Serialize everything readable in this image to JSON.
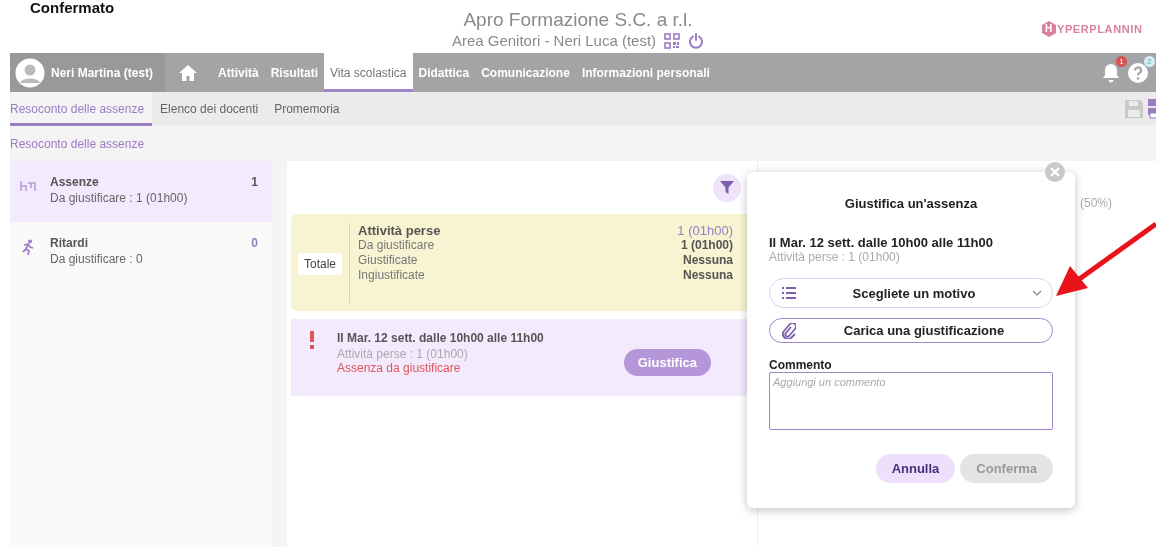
{
  "annotation": {
    "caption": "Confermato"
  },
  "header": {
    "title": "Apro Formazione S.C. a r.l.",
    "subtitle": "Area Genitori - Neri Luca (test)",
    "logo_initial": "H",
    "logo_rest": "YPERPLANNIN"
  },
  "nav": {
    "user": "Neri Martina (test)",
    "items": [
      {
        "label": "Attività",
        "selected": false
      },
      {
        "label": "Risultati",
        "selected": false
      },
      {
        "label": "Vita scolastica",
        "selected": true
      },
      {
        "label": "Didattica",
        "selected": false
      },
      {
        "label": "Comunicazione",
        "selected": false
      },
      {
        "label": "Informazioni personali",
        "selected": false
      }
    ],
    "notifications_badge": "1",
    "help_badge": "2"
  },
  "subtabs": [
    {
      "label": "Resoconto delle assenze",
      "selected": true
    },
    {
      "label": "Elenco dei docenti",
      "selected": false
    },
    {
      "label": "Promemoria",
      "selected": false
    }
  ],
  "breadcrumb": "Resoconto delle assenze",
  "sidebar": {
    "items": [
      {
        "kind": "absence",
        "label": "Assenze",
        "detail": "Da giustificare : 1 (01h00)",
        "count": "1",
        "selected": true
      },
      {
        "kind": "delay",
        "label": "Ritardi",
        "detail": "Da giustificare : 0",
        "count": "0",
        "selected": false
      }
    ]
  },
  "summary": {
    "tag": "Totale",
    "title": "Attività perse",
    "total": "1 (01h00)",
    "rows": [
      {
        "label": "Da giustificare",
        "value": "1 (01h00)"
      },
      {
        "label": "Giustificate",
        "value": "Nessuna"
      },
      {
        "label": "Ingiustificate",
        "value": "Nessuna"
      }
    ]
  },
  "absence": {
    "title": "Il Mar. 12 sett. dalle 10h00 alle 11h00",
    "detail": "Attività perse : 1 (01h00)",
    "status": "Assenza da giustificare",
    "button": "Giustifica"
  },
  "side_panel": {
    "percent": "(50%)"
  },
  "modal": {
    "title": "Giustifica un'assenza",
    "date": "Il Mar. 12 sett. dalle 10h00 alle 11h00",
    "detail": "Attività perse : 1 (01h00)",
    "reason_placeholder": "Scegliete un motivo",
    "upload": "Carica una giustificazione",
    "comment_label": "Commento",
    "comment_placeholder": "Aggiungi un commento",
    "buttons": [
      {
        "label": "Annulla",
        "disabled": false
      },
      {
        "label": "Conferma",
        "disabled": true
      }
    ]
  }
}
